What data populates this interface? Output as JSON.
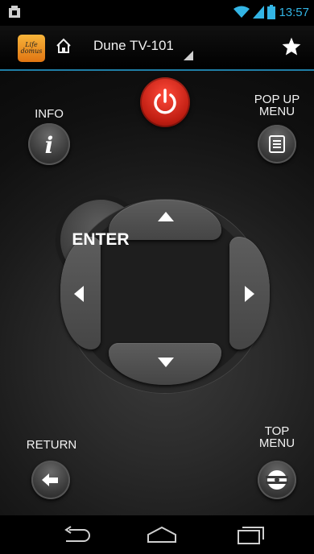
{
  "status_bar": {
    "time": "13:57",
    "icons": [
      "notification-icon",
      "wifi-icon",
      "signal-icon",
      "battery-icon"
    ],
    "accent_color": "#33b5e5"
  },
  "action_bar": {
    "app_logo_text": [
      "Life",
      "domus"
    ],
    "device_name": "Dune TV-101",
    "icons": [
      "home-icon",
      "dropdown-indicator-icon",
      "favorite-star-icon"
    ],
    "divider_color": "#1f7ea6"
  },
  "remote": {
    "info_label": "INFO",
    "popup_menu_label": [
      "POP UP",
      "MENU"
    ],
    "enter_label": "ENTER",
    "return_label": "RETURN",
    "top_menu_label": [
      "TOP",
      "MENU"
    ],
    "power_color": "#d3261a",
    "icons": [
      "power-icon",
      "info-icon",
      "menu-list-icon",
      "arrow-up-icon",
      "arrow-down-icon",
      "arrow-left-icon",
      "arrow-right-icon",
      "return-arrow-icon",
      "disc-icon"
    ]
  },
  "nav_bar": {
    "icons": [
      "back-icon",
      "home-outline-icon",
      "recent-apps-icon"
    ]
  }
}
